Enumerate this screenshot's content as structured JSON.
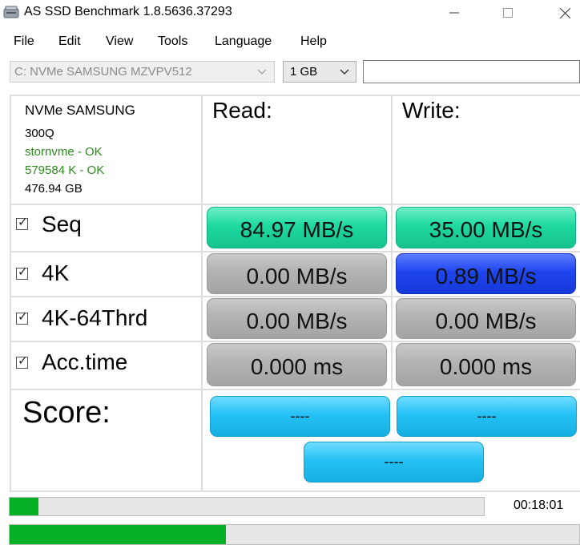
{
  "window": {
    "title": "AS SSD Benchmark 1.8.5636.37293",
    "controls": {
      "minimize": "minimize",
      "maximize": "maximize",
      "close": "close"
    }
  },
  "menu": [
    "File",
    "Edit",
    "View",
    "Tools",
    "Language",
    "Help"
  ],
  "drive_select": {
    "value": "C: NVMe SAMSUNG MZVPV512"
  },
  "size_select": {
    "value": "1 GB"
  },
  "search": {
    "value": ""
  },
  "drive_info": {
    "line1": "NVMe SAMSUNG",
    "line2": "300Q",
    "driver": "stornvme - OK",
    "alignment": "579584 K - OK",
    "capacity": "476.94 GB"
  },
  "columns": {
    "read": "Read:",
    "write": "Write:"
  },
  "rows": [
    {
      "label": "Seq",
      "checked": true,
      "read": "84.97 MB/s",
      "write": "35.00 MB/s"
    },
    {
      "label": "4K",
      "checked": true,
      "read": "0.00 MB/s",
      "write": "0.89 MB/s"
    },
    {
      "label": "4K-64Thrd",
      "checked": true,
      "read": "0.00 MB/s",
      "write": "0.00 MB/s"
    },
    {
      "label": "Acc.time",
      "checked": true,
      "read": "0.000 ms",
      "write": "0.000 ms"
    }
  ],
  "score": {
    "label": "Score:",
    "read": "----",
    "write": "----",
    "total": "----"
  },
  "progress": {
    "current_test_fraction": 0.06,
    "overall_fraction": 0.38,
    "elapsed": "00:18:01"
  },
  "colors": {
    "seq_result": "#1dd9a0",
    "idle_result": "#b3b3b3",
    "active_result": "#1f45f0",
    "score_box": "#25c1f5",
    "progress_fill": "#06b025",
    "ok_text": "#2e8b1f"
  }
}
